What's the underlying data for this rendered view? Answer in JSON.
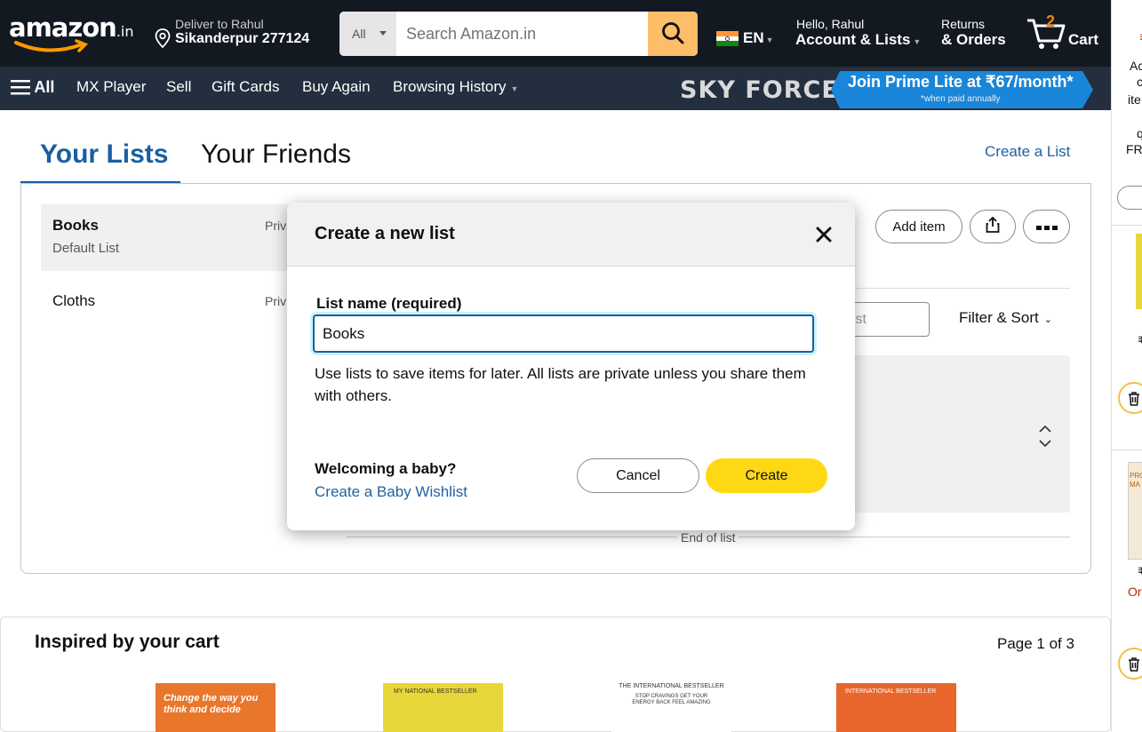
{
  "header": {
    "logo_text": "amazon",
    "logo_suffix": ".in",
    "deliver_line1": "Deliver to Rahul",
    "deliver_line2": "Sikanderpur 277124",
    "search": {
      "category": "All",
      "placeholder": "Search Amazon.in"
    },
    "language": "EN",
    "account_line1": "Hello, Rahul",
    "account_line2": "Account & Lists",
    "returns_line1": "Returns",
    "returns_line2": "& Orders",
    "cart_count": "2",
    "cart_label": "Cart"
  },
  "subnav": {
    "all_label": "All",
    "items": [
      "MX Player",
      "Sell",
      "Gift Cards",
      "Buy Again",
      "Browsing History"
    ],
    "promo_brand": "SKY FORCE",
    "promo_text": "Join Prime Lite at ₹67/month*",
    "promo_note": "*when paid annually"
  },
  "page": {
    "tabs": [
      "Your Lists",
      "Your Friends"
    ],
    "create_list_link": "Create a List",
    "lists": [
      {
        "name": "Books",
        "sub": "Default List",
        "privacy": "Priv"
      },
      {
        "name": "Cloths",
        "sub": "",
        "privacy": "Priv"
      }
    ],
    "add_item": "Add item",
    "search_list_placeholder": "ist",
    "filter_sort": "Filter & Sort",
    "end_of_list": "End of list"
  },
  "bottom": {
    "title": "Inspired by your cart",
    "pagination": "Page 1 of 3",
    "book1_text": "Change the way you think and decide",
    "book2_text": "MY NATIONAL BESTSELLER",
    "book3_line1": "THE INTERNATIONAL BESTSELLER",
    "book3_line2": "STOP CRAVINGS GET YOUR ENERGY BACK FEEL AMAZING",
    "book4_text": "INTERNATIONAL BESTSELLER"
  },
  "sidebar_fragments": {
    "ac": "Ac",
    "c": "c",
    "ite": "ite",
    "q": "q",
    "fr": "FRI",
    "rupee": "₹",
    "or": "Or",
    "pro": "PRO",
    "ma": "MA"
  },
  "modal": {
    "title": "Create a new list",
    "field_label": "List name (required)",
    "field_value": "Books",
    "help_text": "Use lists to save items for later. All lists are private unless you share them with others.",
    "baby_title": "Welcoming a baby?",
    "baby_link": "Create a Baby Wishlist",
    "cancel": "Cancel",
    "create": "Create"
  },
  "colors": {
    "nav_dark": "#131921",
    "subnav": "#232f3e",
    "search_button": "#febd69",
    "link_blue": "#2162a1",
    "create_yellow": "#ffd814",
    "cart_orange": "#f08804"
  }
}
